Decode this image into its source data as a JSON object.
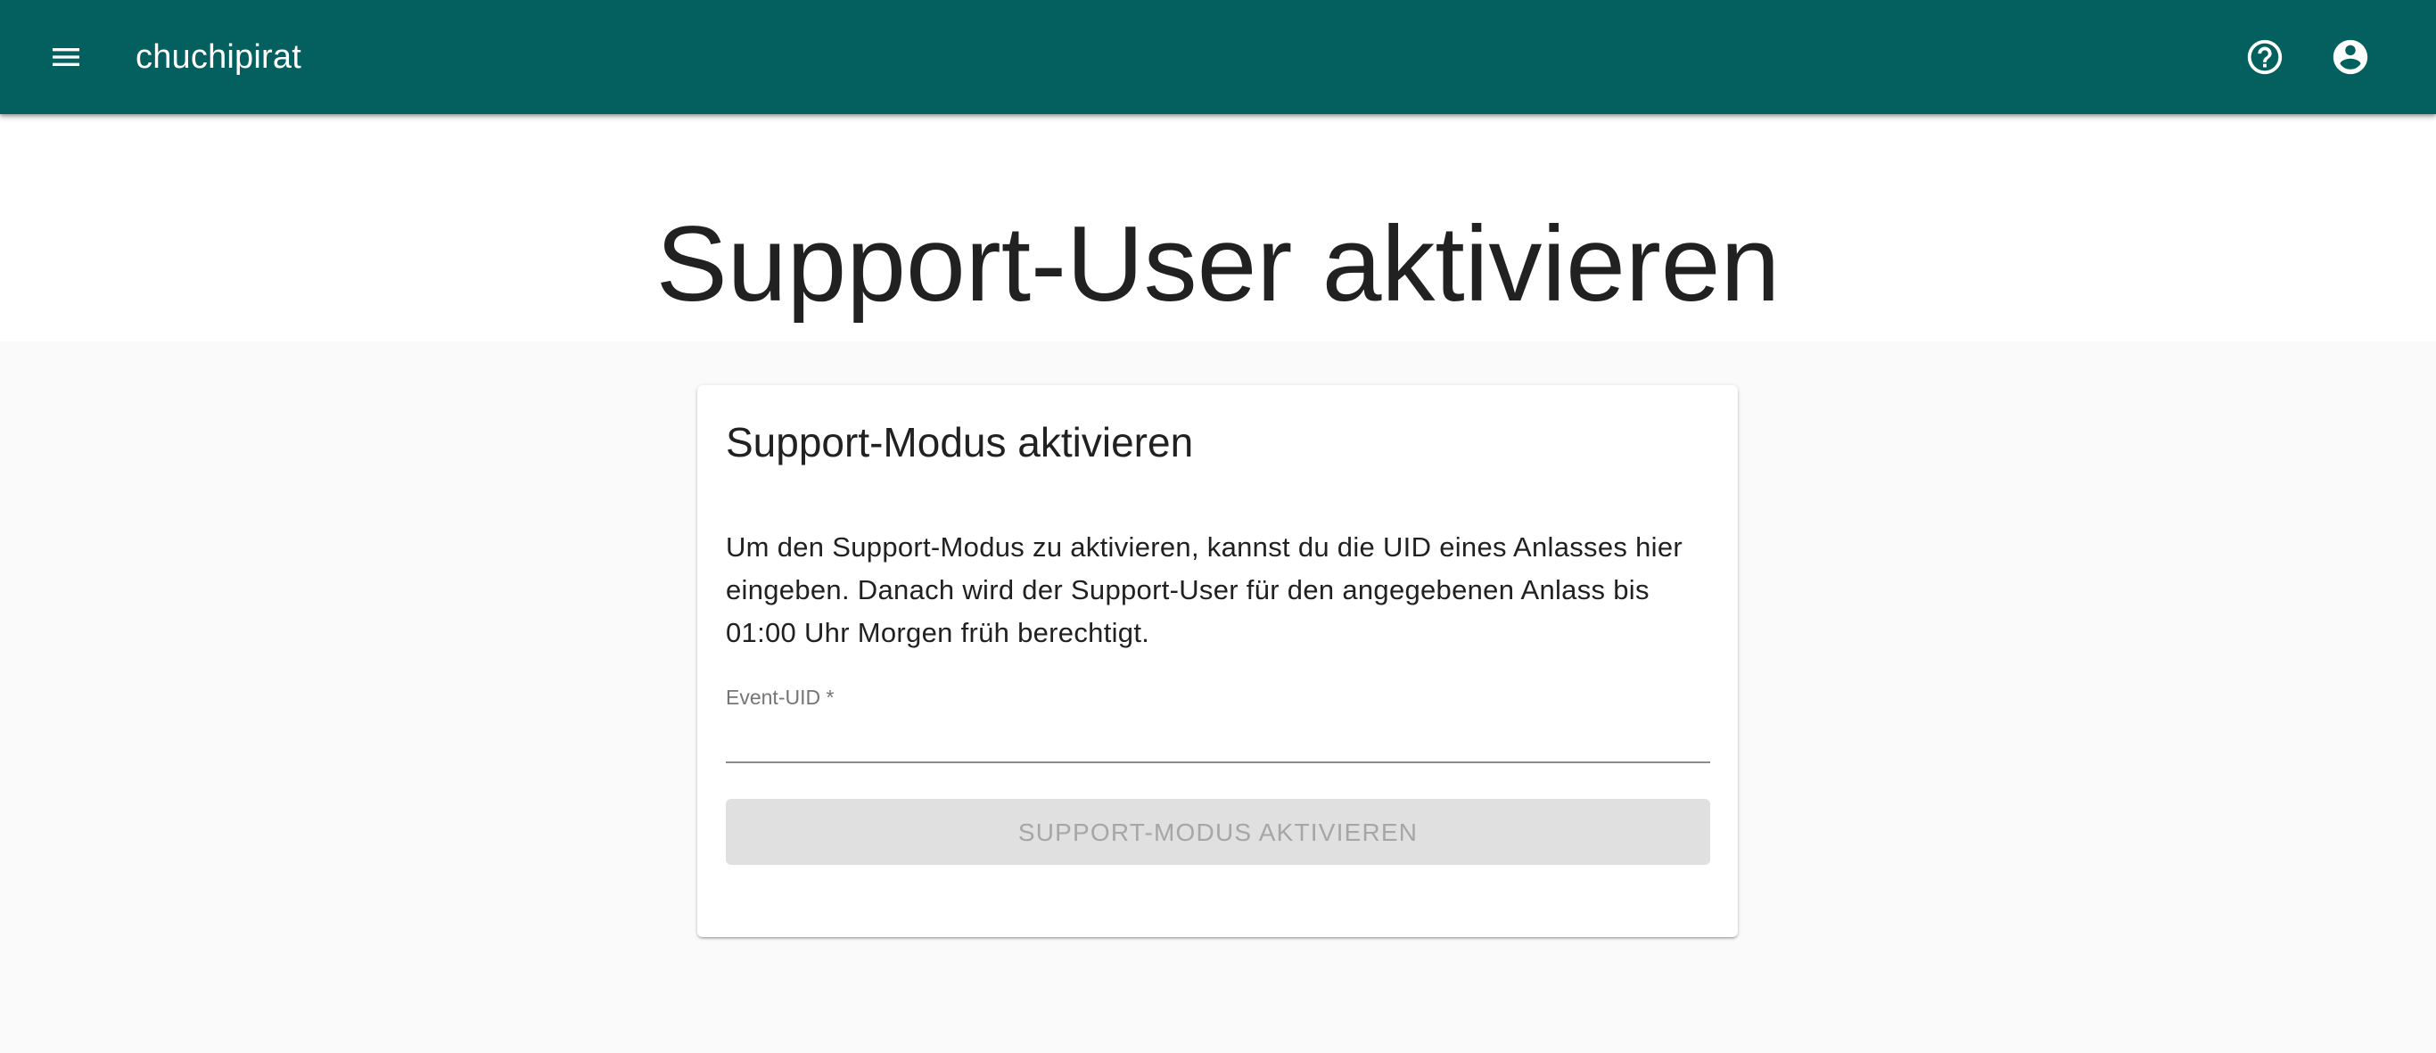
{
  "appbar": {
    "title": "chuchipirat",
    "menu_icon": "menu-icon",
    "help_icon": "help-icon",
    "account_icon": "account-circle-icon",
    "background_color": "#03605f"
  },
  "page": {
    "title": "Support-User aktivieren"
  },
  "card": {
    "title": "Support-Modus aktivieren",
    "description": "Um den Support-Modus zu aktivieren, kannst du die UID eines Anlasses hier eingeben. Danach wird der Support-User für den angegebenen Anlass bis 01:00 Uhr Morgen früh berechtigt.",
    "field": {
      "label": "Event-UID *",
      "value": "",
      "placeholder": ""
    },
    "button_label": "SUPPORT-MODUS AKTIVIEREN",
    "button_disabled": true
  }
}
